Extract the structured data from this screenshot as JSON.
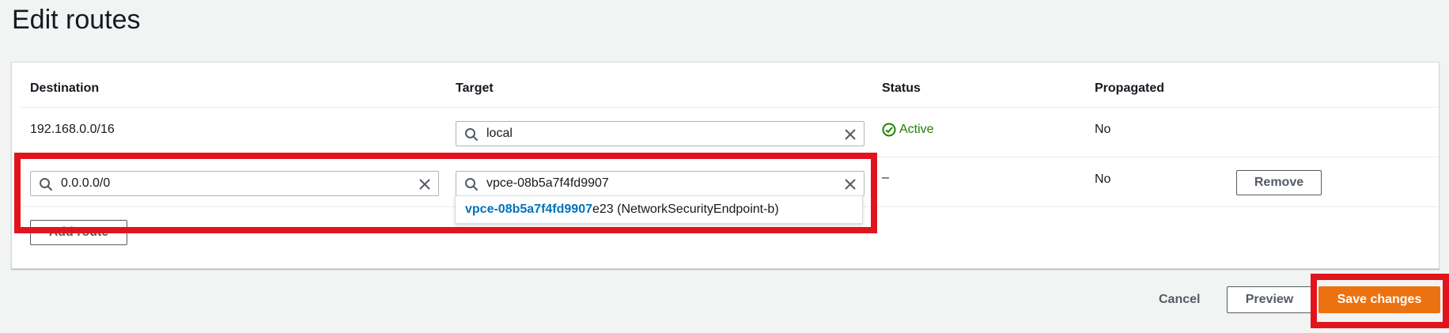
{
  "page": {
    "title": "Edit routes"
  },
  "table": {
    "headers": {
      "destination": "Destination",
      "target": "Target",
      "status": "Status",
      "propagated": "Propagated"
    },
    "rows": [
      {
        "destination": "192.168.0.0/16",
        "target": "local",
        "status": "Active",
        "propagated": "No"
      },
      {
        "destination": "0.0.0.0/0",
        "target": "vpce-08b5a7f4fd9907",
        "status": "–",
        "propagated": "No",
        "remove_label": "Remove"
      }
    ]
  },
  "suggestion": {
    "match": "vpce-08b5a7f4fd9907",
    "rest": "e23 (NetworkSecurityEndpoint-b)"
  },
  "add_route_label": "Add route",
  "footer": {
    "cancel_label": "Cancel",
    "preview_label": "Preview",
    "save_label": "Save changes"
  },
  "colors": {
    "primary": "#ec7211",
    "link": "#0073bb",
    "success": "#1d8102",
    "highlight": "#e1141e"
  },
  "icons": [
    "search-icon",
    "clear-icon",
    "status-check-icon"
  ]
}
